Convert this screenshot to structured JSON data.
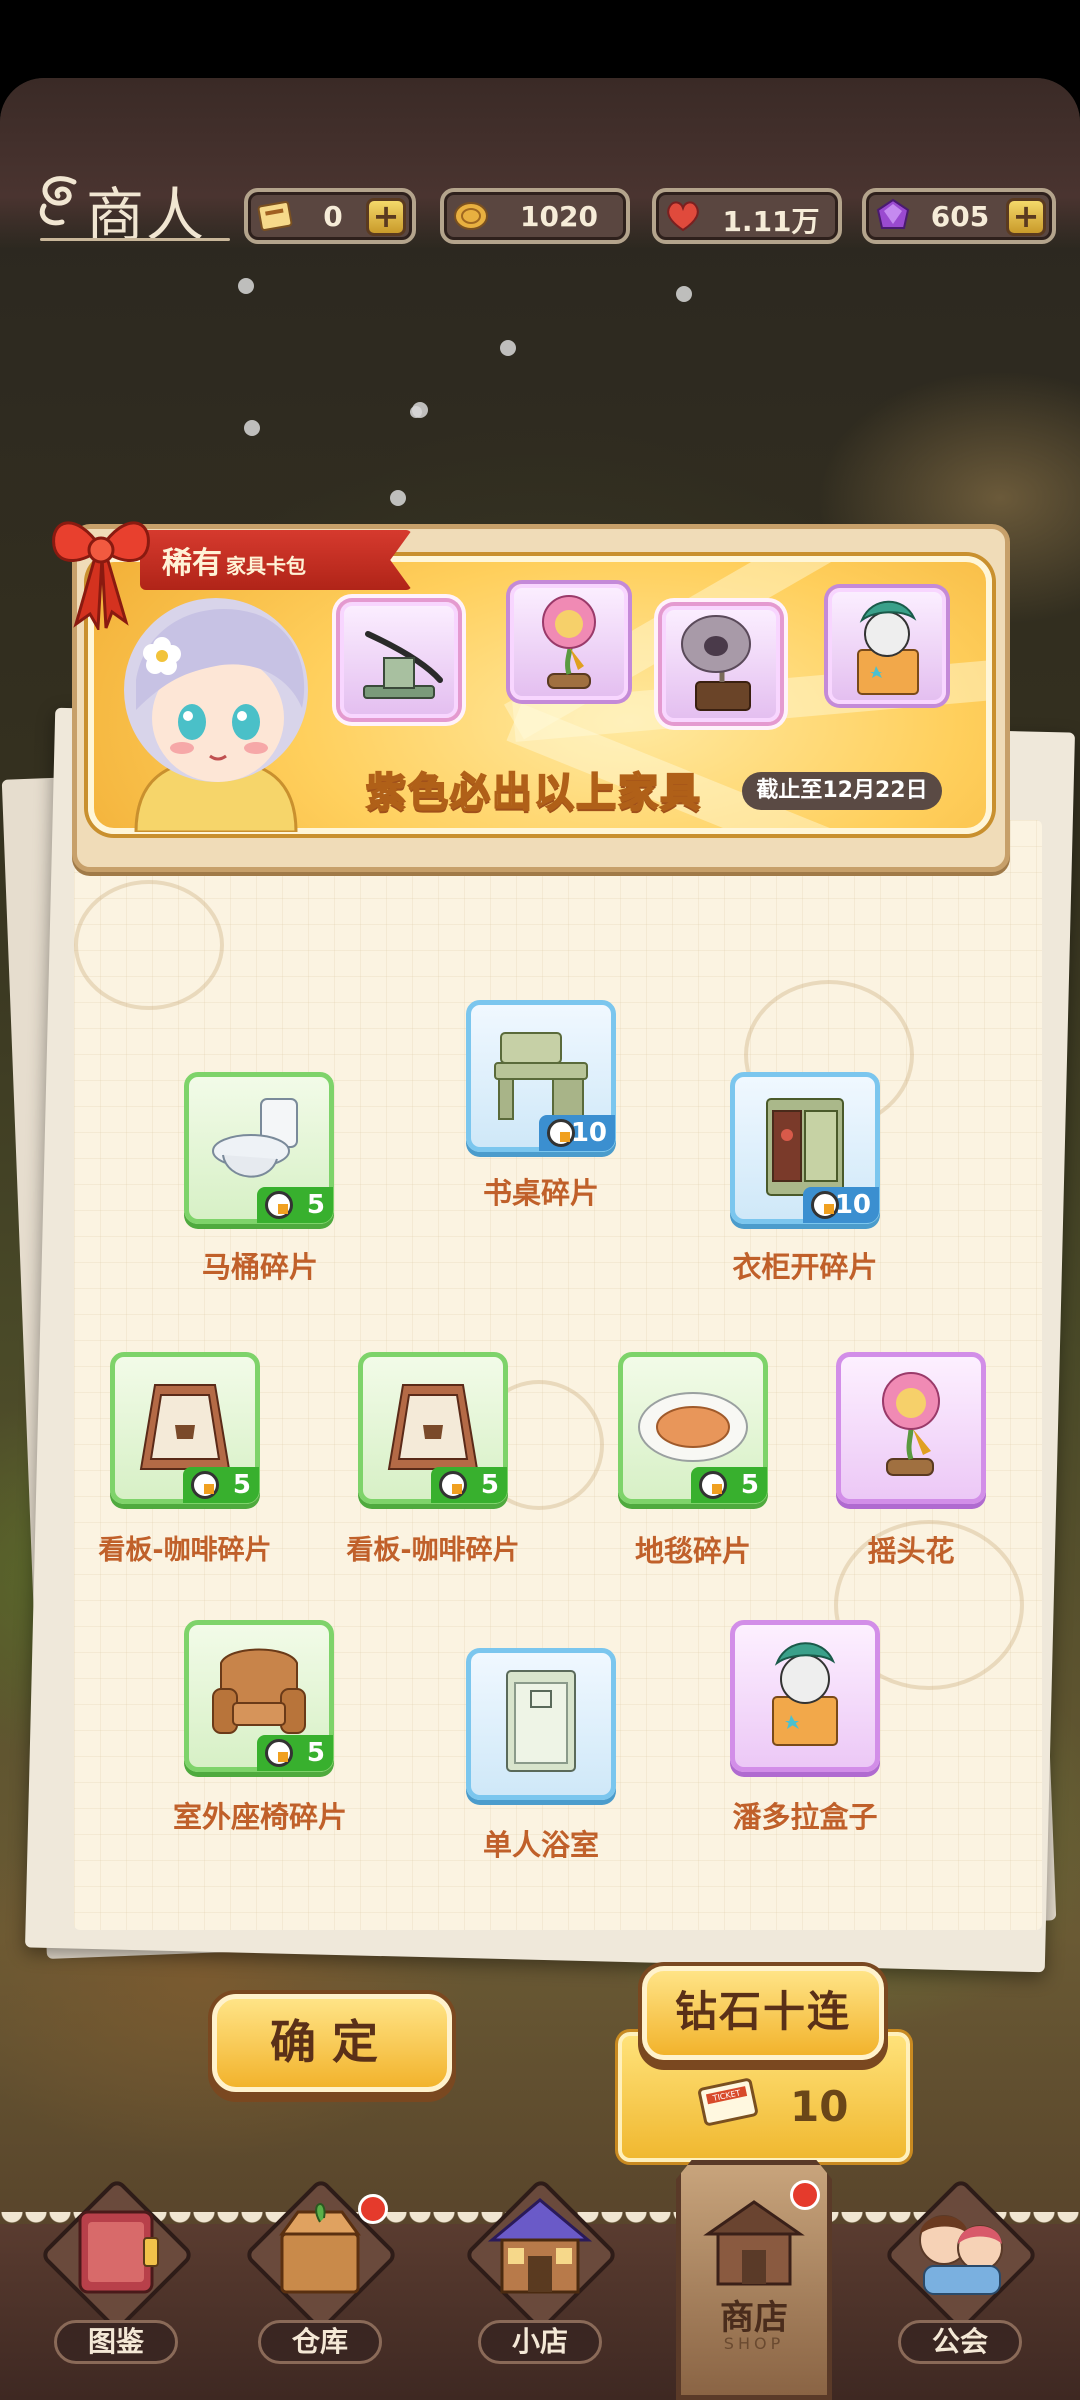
{
  "header": {
    "title": "商人",
    "resources": [
      {
        "name": "ticket",
        "value": "0",
        "has_plus": true
      },
      {
        "name": "coin",
        "value": "1020",
        "has_plus": false
      },
      {
        "name": "heart",
        "value": "1.11万",
        "has_plus": false
      },
      {
        "name": "gem",
        "value": "605",
        "has_plus": true
      }
    ]
  },
  "banner": {
    "tag_big": "稀有",
    "tag_small": "家具卡包",
    "slogan": "紫色必出以上家具",
    "deadline": "截止至12月22日"
  },
  "items": [
    {
      "label": "马桶碎片",
      "count": "5",
      "rarity": "green",
      "icon": "toilet-icon"
    },
    {
      "label": "书桌碎片",
      "count": "10",
      "rarity": "blue",
      "icon": "desk-icon"
    },
    {
      "label": "衣柜开碎片",
      "count": "10",
      "rarity": "blue",
      "icon": "wardrobe-icon"
    },
    {
      "label": "看板-咖啡碎片",
      "count": "5",
      "rarity": "green",
      "icon": "coffee-sign-icon"
    },
    {
      "label": "看板-咖啡碎片",
      "count": "5",
      "rarity": "green",
      "icon": "coffee-sign-icon"
    },
    {
      "label": "地毯碎片",
      "count": "5",
      "rarity": "green",
      "icon": "rug-icon"
    },
    {
      "label": "摇头花",
      "count": "",
      "rarity": "purple",
      "icon": "swaying-flower-icon"
    },
    {
      "label": "室外座椅碎片",
      "count": "5",
      "rarity": "green",
      "icon": "armchair-icon"
    },
    {
      "label": "单人浴室",
      "count": "",
      "rarity": "blue",
      "icon": "shower-cabin-icon"
    },
    {
      "label": "潘多拉盒子",
      "count": "",
      "rarity": "purple",
      "icon": "pandora-box-icon"
    }
  ],
  "actions": {
    "confirm": "确定",
    "ten_pull": "钻石十连",
    "ten_pull_cost": "10",
    "ticket_text": "TICKET"
  },
  "nav": [
    {
      "label": "图鉴",
      "icon": "book-icon",
      "badge": false
    },
    {
      "label": "仓库",
      "icon": "warehouse-box-icon",
      "badge": true
    },
    {
      "label": "小店",
      "icon": "small-shop-icon",
      "badge": false
    },
    {
      "label": "商店",
      "sub": "SHOP",
      "icon": "shop-icon",
      "badge": true,
      "active": true
    },
    {
      "label": "公会",
      "icon": "guild-icon",
      "badge": false
    }
  ],
  "colors": {
    "label_text": "#c0602a",
    "green_rarity": "#7ed36a",
    "blue_rarity": "#7bc6ee",
    "purple_rarity": "#d28ee8",
    "button_gold": "#f2b32c"
  }
}
